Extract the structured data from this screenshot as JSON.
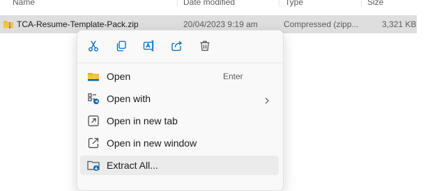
{
  "columns": {
    "name": "Name",
    "date_modified": "Date modified",
    "type": "Type",
    "size": "Size"
  },
  "file": {
    "name": "TCA-Resume-Template-Pack.zip",
    "date_modified": "20/04/2023 9:19 am",
    "type": "Compressed (zipp...",
    "size": "3,321 KB",
    "icon": "zip-folder-icon"
  },
  "context_menu": {
    "quick_actions": [
      {
        "icon": "cut-icon"
      },
      {
        "icon": "copy-icon"
      },
      {
        "icon": "rename-icon"
      },
      {
        "icon": "share-icon"
      },
      {
        "icon": "delete-icon"
      }
    ],
    "items": [
      {
        "label": "Open",
        "accelerator": "Enter",
        "icon": "folder-open-icon"
      },
      {
        "label": "Open with",
        "icon": "open-with-icon",
        "submenu": true
      },
      {
        "label": "Open in new tab",
        "icon": "new-tab-icon"
      },
      {
        "label": "Open in new window",
        "icon": "new-window-icon"
      },
      {
        "label": "Extract All...",
        "icon": "extract-icon"
      }
    ]
  },
  "colors": {
    "accent": "#0067c0",
    "folder_yellow": "#f4c542",
    "selection": "#dedede",
    "menu_hover": "#ebebeb"
  }
}
